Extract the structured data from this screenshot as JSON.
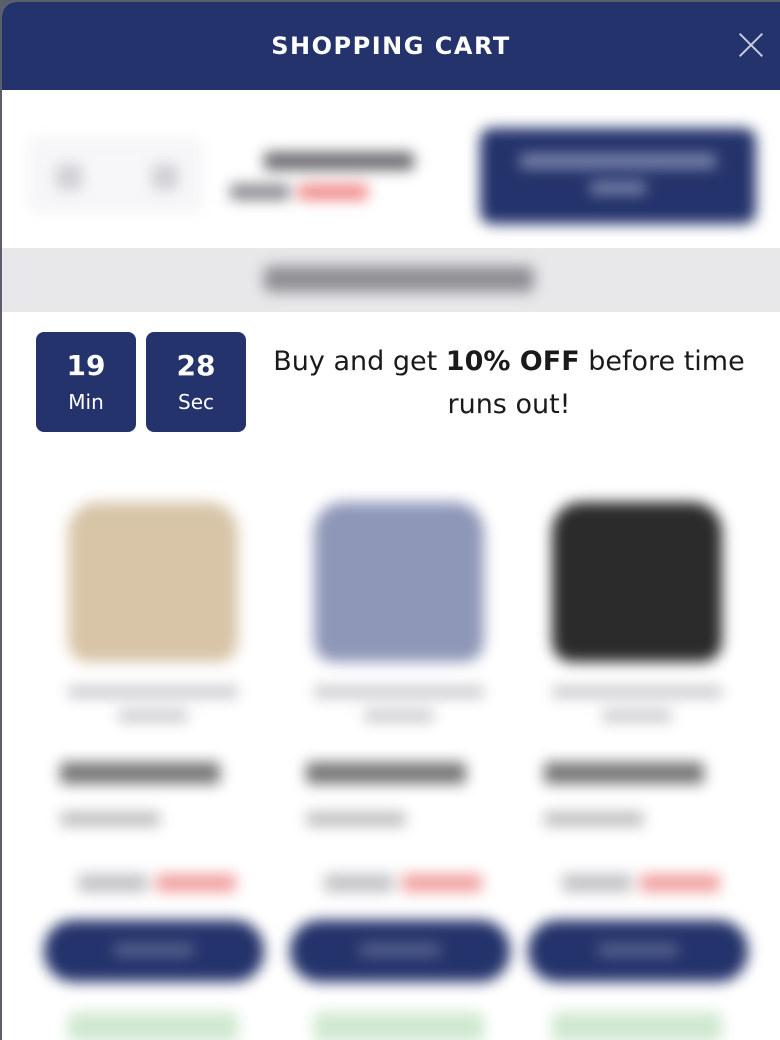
{
  "header": {
    "title": "SHOPPING CART"
  },
  "countdown": {
    "minutes": "19",
    "minutes_label": "Min",
    "seconds": "28",
    "seconds_label": "Sec",
    "message_prefix": "Buy and get ",
    "message_bold": "10% OFF",
    "message_suffix": " before time runs out!"
  },
  "colors": {
    "primary": "#24336b",
    "banner_bg": "#e8e8ea"
  },
  "products": [
    {
      "thumb_color": "#d8c5a8"
    },
    {
      "thumb_color": "#8f97b8"
    },
    {
      "thumb_color": "#2b2b2b"
    }
  ]
}
